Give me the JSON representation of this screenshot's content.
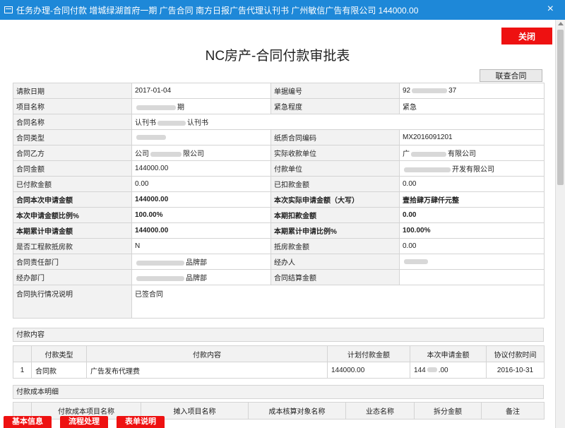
{
  "window": {
    "title": "任务办理-合同付款 增城绿湖首府一期 广告合同 南方日报广告代理认刊书 广州敏信广告有限公司 144000.00",
    "close_symbol": "×"
  },
  "buttons": {
    "close": "关闭",
    "related_contract": "联查合同"
  },
  "page_title": "NC房产-合同付款审批表",
  "form": {
    "request_date_label": "请款日期",
    "request_date": "2017-01-04",
    "doc_no_label": "单据编号",
    "doc_no_a": "92",
    "doc_no_b": "37",
    "project_name_label": "项目名称",
    "project_name_tail": "期",
    "urgency_label": "紧急程度",
    "urgency": "紧急",
    "contract_name_label": "合同名称",
    "contract_name_a": "认刊书",
    "contract_name_b": "认刊书",
    "contract_type_label": "合同类型",
    "paper_contract_no_label": "纸质合同编码",
    "paper_contract_no": "MX2016091201",
    "party_b_label": "合同乙方",
    "party_b_a": "公司",
    "party_b_b": "限公司",
    "payee_label": "实际收款单位",
    "payee_a": "广",
    "payee_b": "有限公司",
    "amount_label": "合同金额",
    "amount": "144000.00",
    "payer_label": "付款单位",
    "payer_b": "开发有限公司",
    "paid_label": "已付款金额",
    "paid": "0.00",
    "deducted_label": "已扣款金额",
    "deducted": "0.00",
    "current_request_label": "合同本次申请金额",
    "current_request": "144000.00",
    "actual_upper_label": "本次实际申请金额（大写）",
    "actual_upper": "壹拾肆万肆仟元整",
    "request_ratio_label": "本次申请金额比例%",
    "request_ratio": "100.00%",
    "period_deduct_label": "本期扣款金额",
    "period_deduct": "0.00",
    "cum_request_label": "本期累计申请金额",
    "cum_request": "144000.00",
    "cum_ratio_label": "本期累计申请比例%",
    "cum_ratio": "100.00%",
    "eng_offset_label": "是否工程款抵房款",
    "eng_offset": "N",
    "offset_amount_label": "抵房款金额",
    "offset_amount": "0.00",
    "resp_dept_label": "合同责任部门",
    "resp_dept_tail": "品牌部",
    "handler_label": "经办人",
    "handler_dept_label": "经办部门",
    "handler_dept_tail": "品牌部",
    "settle_amount_label": "合同结算金额",
    "exec_label": "合同执行情况说明",
    "exec": "已签合同"
  },
  "payment_section": {
    "title": "付款内容",
    "headers": [
      "付款类型",
      "付款内容",
      "计划付款金额",
      "本次申请金额",
      "协议付款时间"
    ],
    "rows": [
      {
        "no": "1",
        "type": "合同款",
        "content": "广告发布代理费",
        "planned": "144000.00",
        "current_a": "144",
        "current_b": ".00",
        "date": "2016-10-31"
      }
    ]
  },
  "cost_section": {
    "title": "付款成本明细",
    "headers": [
      "付款成本项目名称",
      "摊入项目名称",
      "成本核算对象名称",
      "业态名称",
      "拆分金额",
      "备注"
    ]
  },
  "bottom_tabs": [
    "基本信息",
    "流程处理",
    "表单说明"
  ]
}
